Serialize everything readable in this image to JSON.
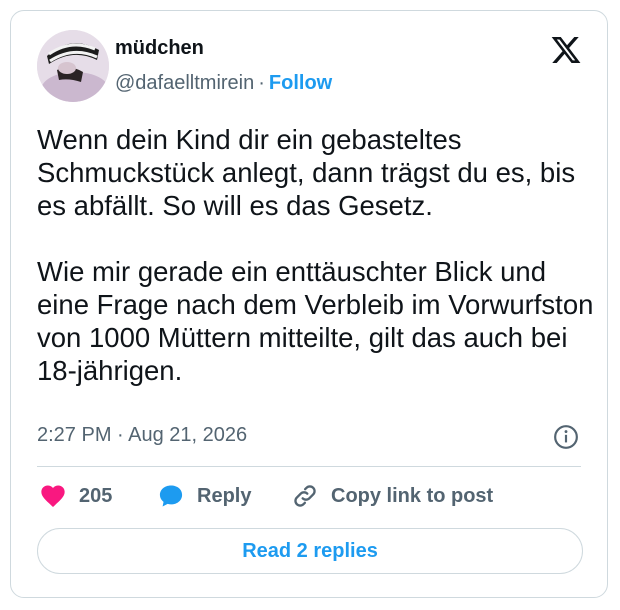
{
  "author": {
    "display_name": "müdchen",
    "handle": "@dafaelltmirein",
    "separator": "·",
    "follow_label": "Follow"
  },
  "tweet": {
    "paragraphs": [
      "Wenn dein Kind dir ein gebasteltes Schmuckstück anlegt, dann trägst du es, bis es abfällt. So will es das Gesetz.",
      "Wie mir gerade ein enttäuschter Blick und eine Frage nach dem Verbleib im Vorwurfston von 1000 Müttern mitteilte, gilt das auch bei 18-jährigen."
    ],
    "timestamp": "2:27 PM · Aug 21, 2026"
  },
  "actions": {
    "like_count": "205",
    "reply_label": "Reply",
    "copy_link_label": "Copy link to post"
  },
  "footer": {
    "read_replies_label": "Read 2 replies"
  },
  "icons": {
    "brand": "x-logo-icon",
    "info": "info-icon",
    "like": "heart-icon",
    "reply": "speech-bubble-icon",
    "copy_link": "link-icon"
  },
  "colors": {
    "accent": "#1d9bf0",
    "like": "#f91880",
    "text": "#0f1419",
    "secondary_text": "#536471",
    "border": "#cfd9de"
  }
}
